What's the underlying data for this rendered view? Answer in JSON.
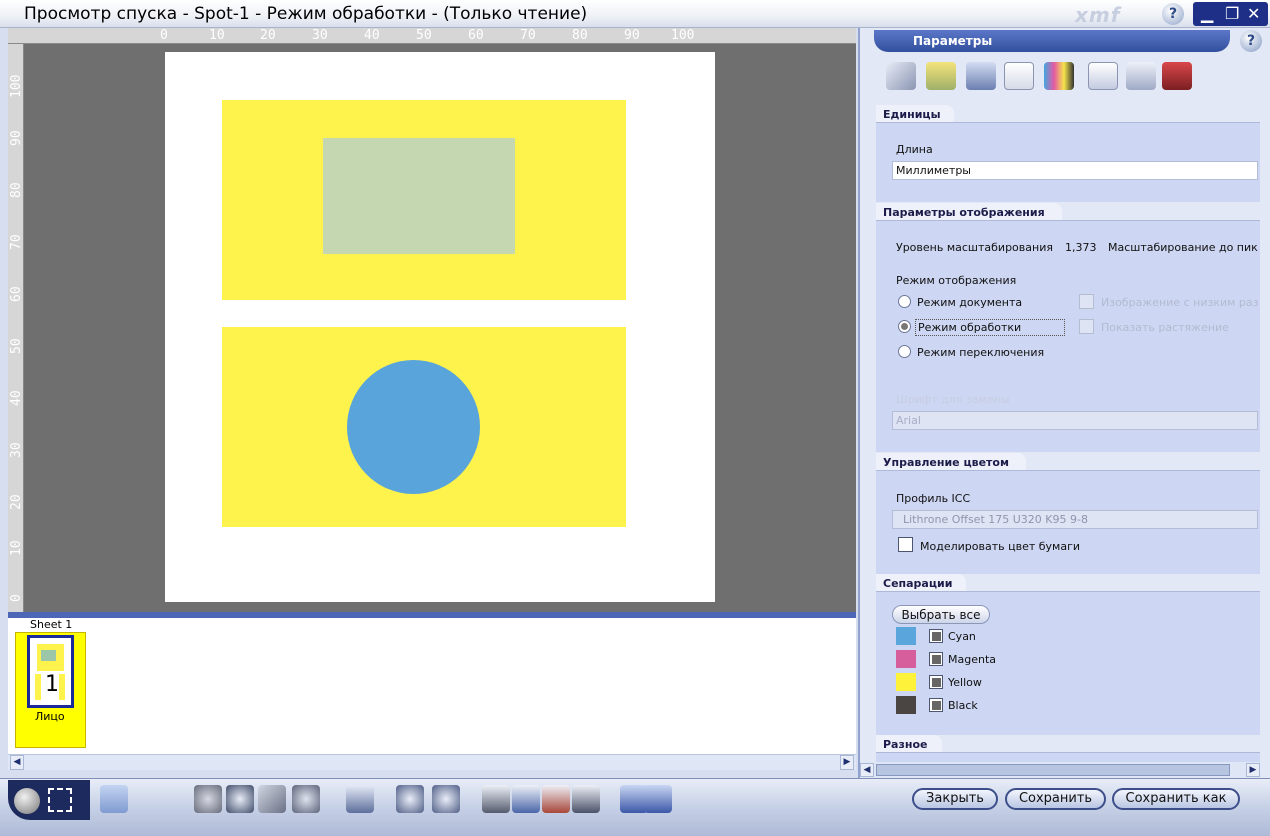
{
  "window": {
    "title": "Просмотр спуска - Spot-1 - Режим обработки - (Только чтение)",
    "brand": "xmf",
    "help": "?"
  },
  "ruler": {
    "top_labels": [
      "0",
      "10",
      "20",
      "30",
      "40",
      "50",
      "60",
      "70",
      "80",
      "90",
      "100"
    ],
    "left_labels": [
      "100",
      "90",
      "80",
      "70",
      "60",
      "50",
      "40",
      "30",
      "20",
      "10",
      "0"
    ]
  },
  "thumbnails": {
    "sheet_label": "Sheet 1",
    "page_number": "1",
    "face_label": "Лицо"
  },
  "panel": {
    "tab_title": "Параметры",
    "help": "?",
    "icons": [
      "measure-icon",
      "layers-icon",
      "print-icon",
      "document-icon",
      "crosshair-icon",
      "info-icon",
      "edit-icon",
      "book-icon"
    ],
    "units": {
      "header": "Единицы",
      "length_label": "Длина",
      "length_value": "Миллиметры"
    },
    "display": {
      "header": "Параметры отображения",
      "zoom_label": "Уровень масштабирования",
      "zoom_value": "1,373",
      "zoom_fit": "Масштабирование до пик",
      "mode_label": "Режим отображения",
      "modes": [
        "Режим документа",
        "Режим обработки",
        "Режим переключения"
      ],
      "selected_mode": "Режим обработки",
      "opt_lowres": "Изображение с низким раз",
      "opt_stretch": "Показать растяжение",
      "font_label": "Шрифт для замены",
      "font_value": "Arial"
    },
    "color": {
      "header": "Управление цветом",
      "icc_label": "Профиль ICC",
      "icc_value": "Lithrone Offset 175 U320 K95 9-8",
      "simulate_paper": "Моделировать цвет бумаги"
    },
    "separations": {
      "header": "Сепарации",
      "select_all": "Выбрать все",
      "items": [
        {
          "name": "Cyan",
          "color": "#5aa5dc"
        },
        {
          "name": "Magenta",
          "color": "#d75e9d"
        },
        {
          "name": "Yellow",
          "color": "#fef23a"
        },
        {
          "name": "Black",
          "color": "#4a4443"
        }
      ]
    },
    "misc": {
      "header": "Разное"
    }
  },
  "bottom": {
    "close": "Закрыть",
    "save": "Сохранить",
    "save_as": "Сохранить как"
  }
}
